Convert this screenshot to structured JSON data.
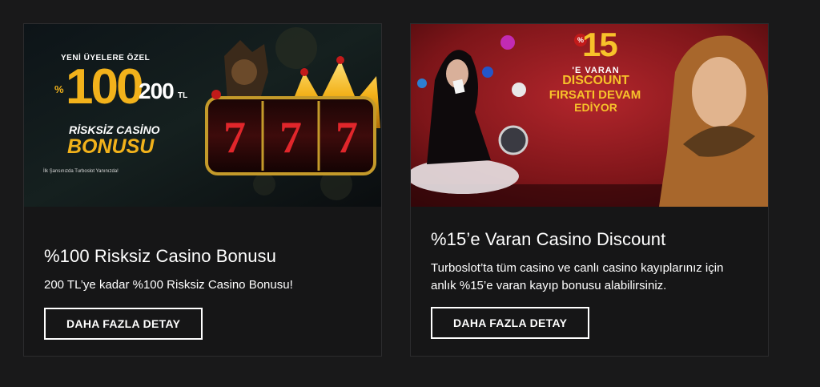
{
  "promotions": [
    {
      "banner": {
        "tagline": "YENİ ÜYELERE ÖZEL",
        "percent_sign": "%",
        "big_number": "100",
        "amount": "200",
        "currency": "TL",
        "line1": "RİSKSİZ CASİNO",
        "line2": "BONUSU",
        "footnote": "İlk Şansınızda Turboslot Yanınızda!"
      },
      "title": "%100 Risksiz Casino Bonusu",
      "description": "200 TL’ye kadar %100 Risksiz Casino Bonusu!",
      "button_label": "DAHA FAZLA DETAY"
    },
    {
      "banner": {
        "percent_sign": "%",
        "big_number": "15",
        "line1": "'E VARAN",
        "line2": "DISCOUNT",
        "line3": "FIRSATI DEVAM",
        "line4": "EDİYOR"
      },
      "title": "%15’e Varan Casino Discount",
      "description": "Turboslot’ta tüm casino ve canlı casino kayıplarınız için anlık %15’e varan kayıp bonusu alabilirsiniz.",
      "button_label": "DAHA FAZLA DETAY"
    }
  ],
  "colors": {
    "page_bg": "#19191a",
    "card_bg": "#161617",
    "gold": "#f2b21b",
    "red_banner": "#8b1a1f"
  }
}
